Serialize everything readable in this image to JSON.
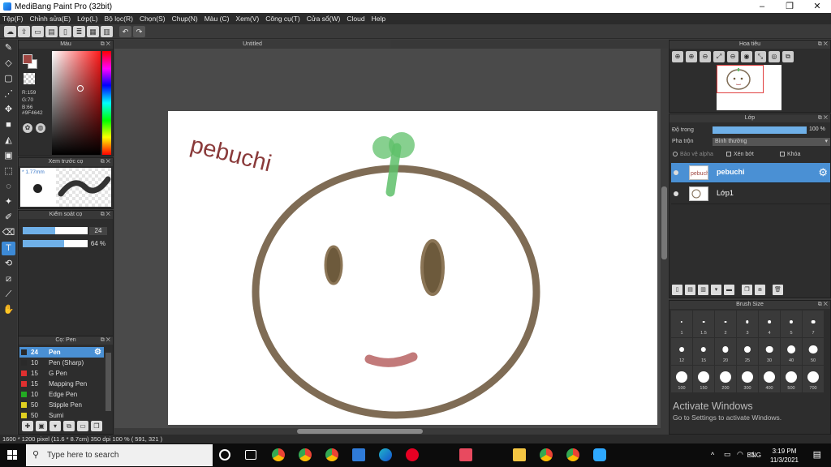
{
  "window": {
    "title": "MediBang Paint Pro (32bit)",
    "controls": [
      "–",
      "❐",
      "✕"
    ]
  },
  "menu": [
    "Tệp(F)",
    "Chỉnh sửa(E)",
    "Lớp(L)",
    "Bộ lọc(R)",
    "Chọn(S)",
    "Chụp(N)",
    "Màu (C)",
    "Xem(V)",
    "Công cụ(T)",
    "Cửa sổ(W)",
    "Cloud",
    "Help"
  ],
  "color_panel": {
    "title": "Màu",
    "r": "R:159",
    "g": "G:70",
    "b": "B:66",
    "hex": "#9F4642",
    "fg_color": "#9f4642"
  },
  "preview_panel": {
    "title": "Xem trước cọ",
    "size": "* 1.77mm"
  },
  "control_panel": {
    "title": "Kiểm soát cọ",
    "size_value": "24",
    "size_fill": 0.5,
    "opacity_value": "64 %",
    "opacity_fill": 0.64
  },
  "brush_panel": {
    "title": "Cọ: Pen",
    "brushes": [
      {
        "num": "24",
        "name": "Pen",
        "color": "#2a2a2a",
        "selected": true
      },
      {
        "num": "10",
        "name": "Pen (Sharp)",
        "color": "#2a2a2a",
        "selected": false
      },
      {
        "num": "15",
        "name": "G Pen",
        "color": "#e03030",
        "selected": false
      },
      {
        "num": "15",
        "name": "Mapping Pen",
        "color": "#e03030",
        "selected": false
      },
      {
        "num": "10",
        "name": "Edge Pen",
        "color": "#22aa22",
        "selected": false
      },
      {
        "num": "50",
        "name": "Stipple Pen",
        "color": "#e0d020",
        "selected": false
      },
      {
        "num": "50",
        "name": "Sumi",
        "color": "#e0d020",
        "selected": false
      }
    ]
  },
  "canvas": {
    "tab": "Untitled",
    "text": "pebuchi"
  },
  "navigator": {
    "title": "Hoa tiêu",
    "tools": [
      "⊕",
      "⊕",
      "⊖",
      "⤢",
      "⊖",
      "◉",
      "⤡",
      "◎",
      "⧉"
    ]
  },
  "layer_panel": {
    "title": "Lớp",
    "opacity_label": "Độ trong",
    "opacity_value": "100 %",
    "blend_label": "Pha trộn",
    "blend_value": "Bình thường",
    "protect_alpha": "Bảo vệ alpha",
    "clip": "Xén bớt",
    "lock": "Khóa",
    "layers": [
      {
        "name": "pebuchi",
        "selected": true
      },
      {
        "name": "Lớp1",
        "selected": false
      }
    ]
  },
  "brush_size": {
    "title": "Brush Size",
    "sizes": [
      "1",
      "1.5",
      "2",
      "3",
      "4",
      "5",
      "7",
      "12",
      "15",
      "20",
      "25",
      "30",
      "40",
      "50",
      "100",
      "150",
      "200",
      "300",
      "400",
      "500",
      "700"
    ]
  },
  "activate": {
    "line1": "Activate Windows",
    "line2": "Go to Settings to activate Windows."
  },
  "status": {
    "text": "1600 * 1200 pixel   (11.6 * 8.7cm)   350 dpi   100 %   ( 591, 321 )"
  },
  "taskbar": {
    "search_placeholder": "Type here to search",
    "lang": "ENG",
    "time": "3:19 PM",
    "date": "11/3/2021"
  }
}
